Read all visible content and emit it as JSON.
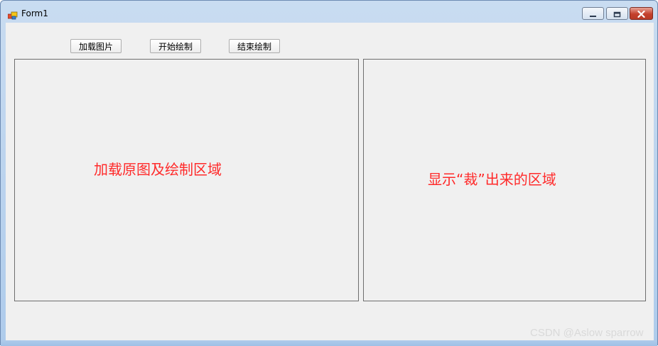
{
  "window": {
    "title": "Form1"
  },
  "toolbar": {
    "load_image": "加载图片",
    "start_draw": "开始绘制",
    "end_draw": "结束绘制"
  },
  "left_panel": {
    "label": "加载原图及绘制区域"
  },
  "right_panel": {
    "label": "显示“裁”出来的区域"
  },
  "watermark": "CSDN @Aslow sparrow",
  "colors": {
    "label_red": "#ff2a2a",
    "client_bg": "#f0f0f0",
    "titlebar": "#bfd6ef"
  },
  "icons": {
    "app": "form-app-icon",
    "minimize": "minimize-icon",
    "maximize": "maximize-icon",
    "close": "close-icon"
  }
}
